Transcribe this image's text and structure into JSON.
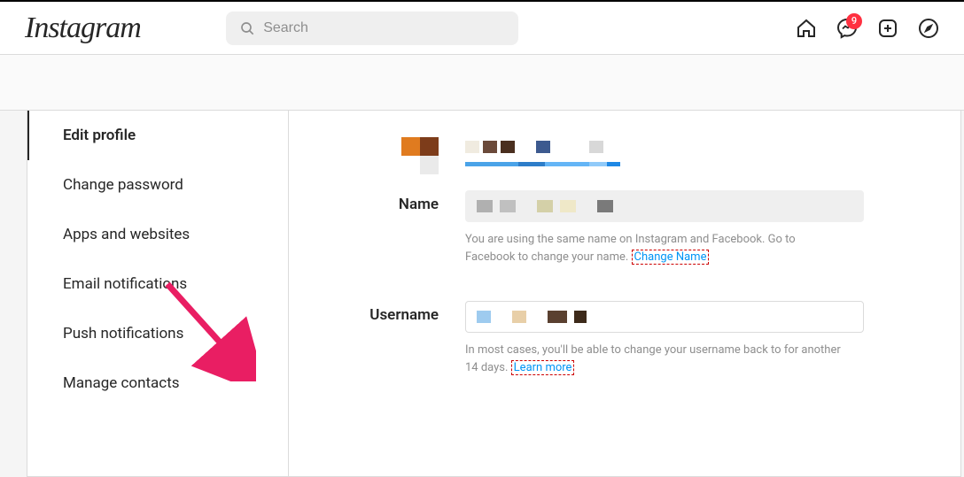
{
  "brand": "Instagram",
  "search": {
    "placeholder": "Search"
  },
  "notifications": {
    "messenger_badge": "9"
  },
  "sidebar": {
    "items": [
      {
        "label": "Edit profile"
      },
      {
        "label": "Change password"
      },
      {
        "label": "Apps and websites"
      },
      {
        "label": "Email notifications"
      },
      {
        "label": "Push notifications"
      },
      {
        "label": "Manage contacts"
      }
    ]
  },
  "form": {
    "name_label": "Name",
    "username_label": "Username",
    "name_help_1": "You are using the same name on Instagram and Facebook. Go to Facebook to change your name. ",
    "name_help_link": "Change Name",
    "username_help_1": "In most cases, you'll be able to change your username back to",
    "username_help_2": " for another 14 days. ",
    "username_help_link": "Learn more"
  }
}
